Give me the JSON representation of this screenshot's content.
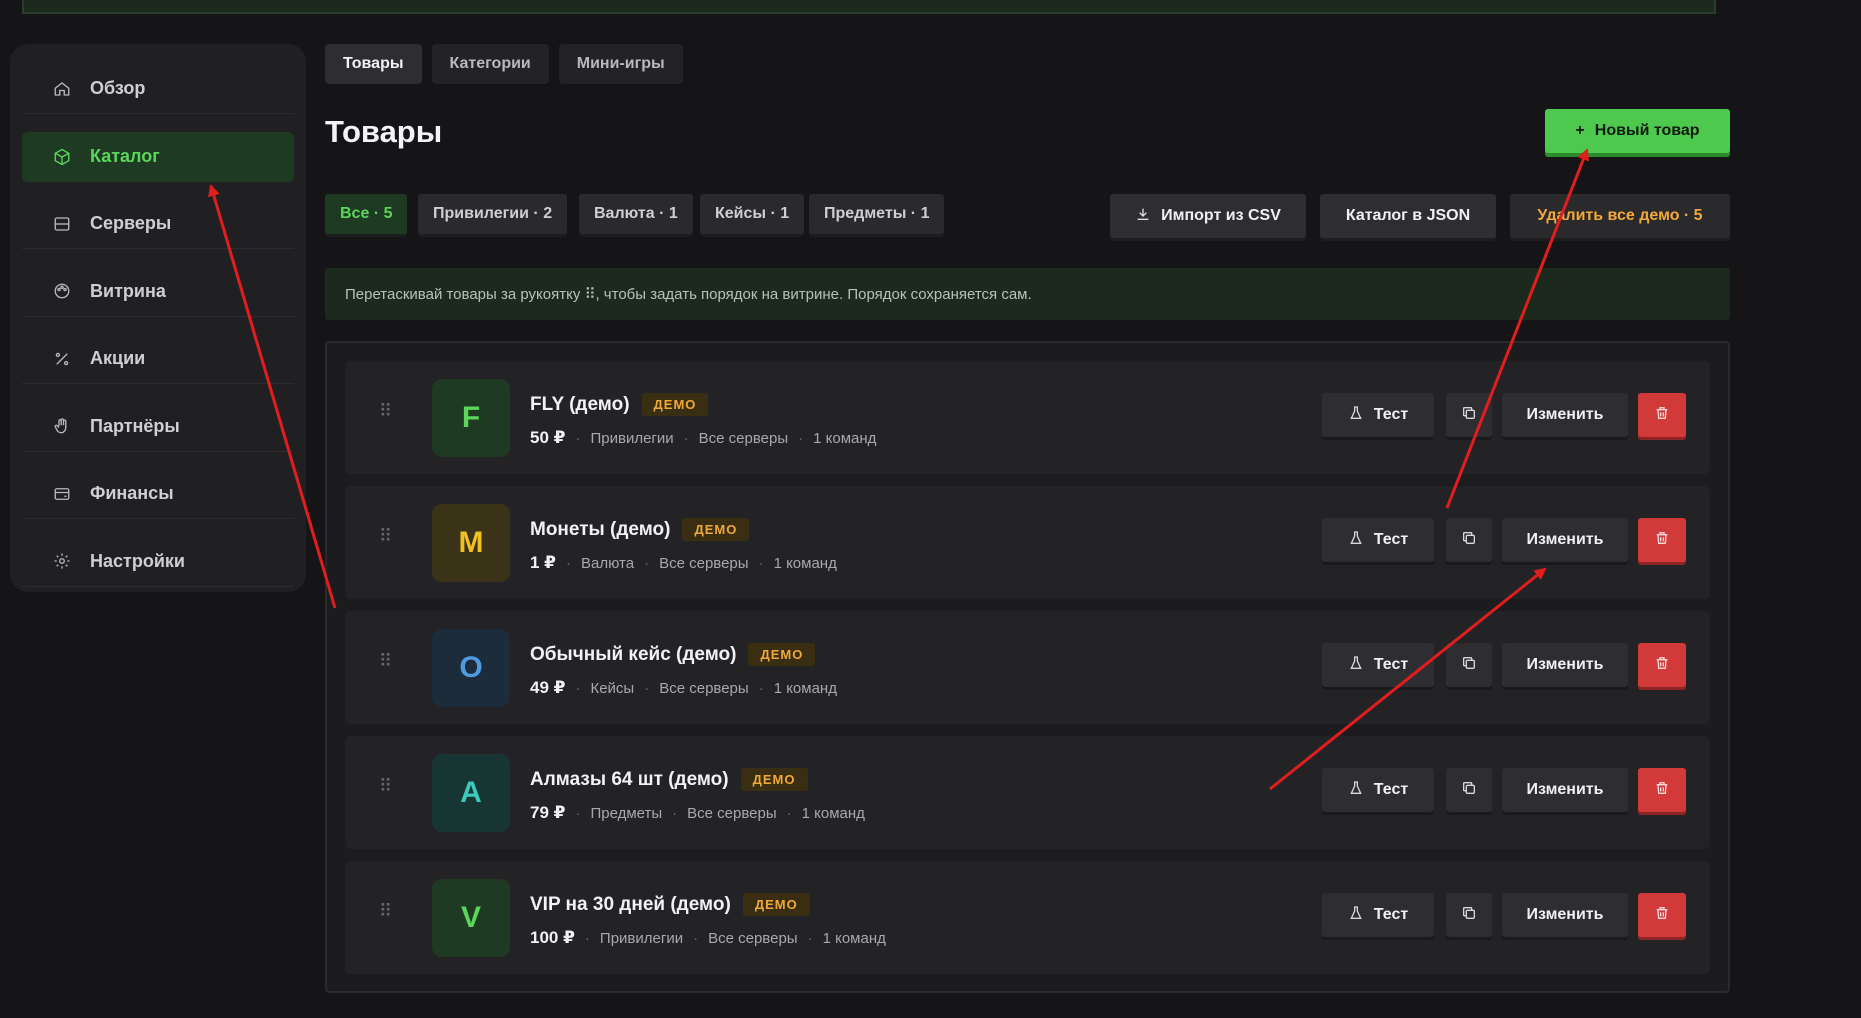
{
  "sidebar": {
    "items": [
      {
        "label": "Обзор",
        "icon": "home-icon",
        "active": false
      },
      {
        "label": "Каталог",
        "icon": "box-icon",
        "active": true
      },
      {
        "label": "Серверы",
        "icon": "server-icon",
        "active": false
      },
      {
        "label": "Витрина",
        "icon": "palette-icon",
        "active": false
      },
      {
        "label": "Акции",
        "icon": "percent-icon",
        "active": false
      },
      {
        "label": "Партнёры",
        "icon": "hand-icon",
        "active": false
      },
      {
        "label": "Финансы",
        "icon": "wallet-icon",
        "active": false
      },
      {
        "label": "Настройки",
        "icon": "gear-icon",
        "active": false
      }
    ]
  },
  "tabs": [
    {
      "label": "Товары",
      "active": true
    },
    {
      "label": "Категории",
      "active": false
    },
    {
      "label": "Мини-игры",
      "active": false
    }
  ],
  "page": {
    "title": "Товары",
    "new_button": "Новый товар"
  },
  "filters": [
    {
      "label": "Все · 5",
      "active": true
    },
    {
      "label": "Привилегии · 2",
      "active": false
    },
    {
      "label": "Валюта · 1",
      "active": false
    },
    {
      "label": "Кейсы · 1",
      "active": false
    },
    {
      "label": "Предметы · 1",
      "active": false
    }
  ],
  "actions": {
    "import_csv": "Импорт из CSV",
    "catalog_json": "Каталог в JSON",
    "delete_demo": "Удалить все демо · 5"
  },
  "hint": "Перетаскивай товары за рукоятку ⠿, чтобы задать порядок на витрине. Порядок сохраняется сам.",
  "row_buttons": {
    "test": "Тест",
    "edit": "Изменить"
  },
  "products": [
    {
      "letter": "F",
      "name": "FLY (демо)",
      "badge": "ДЕМО",
      "price": "50 ₽",
      "category": "Привилегии",
      "servers": "Все серверы",
      "commands": "1 команд",
      "bg": "#1f3a23",
      "fg": "#5bd65b"
    },
    {
      "letter": "M",
      "name": "Монеты (демо)",
      "badge": "ДЕМО",
      "price": "1 ₽",
      "category": "Валюта",
      "servers": "Все серверы",
      "commands": "1 команд",
      "bg": "#3a3318",
      "fg": "#f0c020"
    },
    {
      "letter": "O",
      "name": "Обычный кейс (демо)",
      "badge": "ДЕМО",
      "price": "49 ₽",
      "category": "Кейсы",
      "servers": "Все серверы",
      "commands": "1 команд",
      "bg": "#1d2c3a",
      "fg": "#4f9be0"
    },
    {
      "letter": "A",
      "name": "Алмазы 64 шт (демо)",
      "badge": "ДЕМО",
      "price": "79 ₽",
      "category": "Предметы",
      "servers": "Все серверы",
      "commands": "1 команд",
      "bg": "#163533",
      "fg": "#3dc9bd"
    },
    {
      "letter": "V",
      "name": "VIP на 30 дней (демо)",
      "badge": "ДЕМО",
      "price": "100 ₽",
      "category": "Привилегии",
      "servers": "Все серверы",
      "commands": "1 команд",
      "bg": "#1f3a23",
      "fg": "#5bd65b"
    }
  ],
  "colors": {
    "accent": "#4dc94d",
    "warn": "#f2a93b",
    "danger": "#d23a3a",
    "annotation": "#e11d1d"
  }
}
